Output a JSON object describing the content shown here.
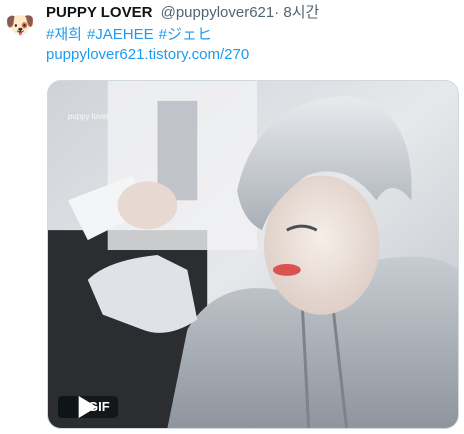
{
  "tweet": {
    "avatar_icon": "puppy-face-emoji",
    "avatar_glyph": "🐶",
    "display_name": "PUPPY LOVER",
    "handle": "@puppylover621",
    "separator": "·",
    "time": "8시간",
    "hashtags": [
      "#재희",
      "#JAEHEE",
      "#ジェヒ"
    ],
    "link": "puppylover621.tistory.com/270"
  },
  "media": {
    "watermark": "puppy lover",
    "badge_icon": "play-icon",
    "badge_label": "GIF"
  },
  "colors": {
    "link": "#1d9bf0",
    "secondary_text": "#536471",
    "primary_text": "#0f1419"
  }
}
